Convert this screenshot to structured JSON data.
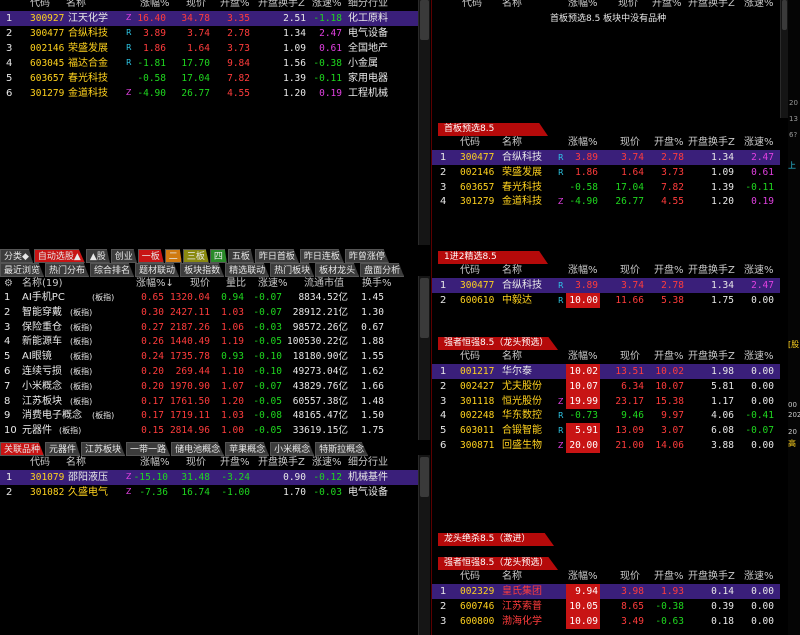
{
  "table_header": {
    "code": "代码",
    "name": "名称",
    "change": "涨幅%",
    "price": "现价",
    "open": "开盘%",
    "turnover": "开盘换手Z",
    "speed": "涨速%",
    "industry": "细分行业"
  },
  "top_left": {
    "rows": [
      {
        "idx": "1",
        "code": "300927",
        "name": "江天化学",
        "flag": "Z",
        "change": "16.40",
        "price": "34.78",
        "open": "3.35",
        "turnover": "2.51",
        "speed": "-1.18",
        "industry": "化工原料"
      },
      {
        "idx": "2",
        "code": "300477",
        "name": "合纵科技",
        "flag": "R",
        "change": "3.89",
        "price": "3.74",
        "open": "2.78",
        "turnover": "1.34",
        "speed": "2.47",
        "industry": "电气设备"
      },
      {
        "idx": "3",
        "code": "002146",
        "name": "荣盛发展",
        "flag": "R",
        "change": "1.86",
        "price": "1.64",
        "open": "3.73",
        "turnover": "1.09",
        "speed": "0.61",
        "industry": "全国地产"
      },
      {
        "idx": "4",
        "code": "603045",
        "name": "福达合金",
        "flag": "R",
        "change": "-1.81",
        "price": "17.70",
        "open": "9.84",
        "turnover": "1.56",
        "speed": "-0.38",
        "industry": "小金属"
      },
      {
        "idx": "5",
        "code": "603657",
        "name": "春光科技",
        "flag": "",
        "change": "-0.58",
        "price": "17.04",
        "open": "7.82",
        "turnover": "1.39",
        "speed": "-0.11",
        "industry": "家用电器"
      },
      {
        "idx": "6",
        "code": "301279",
        "name": "金道科技",
        "flag": "Z",
        "change": "-4.90",
        "price": "26.77",
        "open": "4.55",
        "turnover": "1.20",
        "speed": "0.19",
        "industry": "工程机械"
      }
    ]
  },
  "top_right": {
    "message": "首板预选8.5 板块中没有品种",
    "side_numbers": [
      "20",
      "13",
      "6?"
    ],
    "side_label": "上证"
  },
  "tabs1": [
    {
      "label": "分类◆",
      "style": ""
    },
    {
      "label": "自动选股▲",
      "style": "act"
    },
    {
      "label": "▲股",
      "style": ""
    },
    {
      "label": "创业",
      "style": ""
    },
    {
      "label": "一板",
      "style": "act"
    },
    {
      "label": "二",
      "style": "act2"
    },
    {
      "label": "三板",
      "style": "act4"
    },
    {
      "label": "四",
      "style": "act3"
    },
    {
      "label": "五板",
      "style": ""
    },
    {
      "label": "昨日首板",
      "style": ""
    },
    {
      "label": "昨日连板",
      "style": ""
    },
    {
      "label": "昨曾涨停",
      "style": ""
    }
  ],
  "tabs2": [
    {
      "label": "最近浏览",
      "style": ""
    },
    {
      "label": "热门分布",
      "style": ""
    },
    {
      "label": "综合排名",
      "style": ""
    },
    {
      "label": "题材联动",
      "style": ""
    },
    {
      "label": "板块指数",
      "style": ""
    },
    {
      "label": "精选联动",
      "style": ""
    },
    {
      "label": "热门板块",
      "style": ""
    },
    {
      "label": "板材龙头",
      "style": ""
    },
    {
      "label": "盘面分析",
      "style": ""
    }
  ],
  "sector_panel": {
    "header": {
      "name": "名称(19)",
      "change": "涨幅%↓",
      "price": "现价",
      "ratio": "量比",
      "speed": "涨速%",
      "cap": "流通市值",
      "turnover": "换手%"
    },
    "rows": [
      {
        "idx": "1",
        "name": "AI手机PC",
        "tag": "(板指)",
        "change": "0.65",
        "price": "1320.04",
        "ratio": "0.94",
        "speed": "-0.07",
        "cap": "8834.52亿",
        "turnover": "1.45"
      },
      {
        "idx": "2",
        "name": "智能穿戴",
        "tag": "(板指)",
        "change": "0.30",
        "price": "2427.11",
        "ratio": "1.03",
        "speed": "-0.07",
        "cap": "28912.21亿",
        "turnover": "1.30"
      },
      {
        "idx": "3",
        "name": "保险重仓",
        "tag": "(板指)",
        "change": "0.27",
        "price": "2187.26",
        "ratio": "1.06",
        "speed": "-0.03",
        "cap": "98572.26亿",
        "turnover": "0.67"
      },
      {
        "idx": "4",
        "name": "新能源车",
        "tag": "(板指)",
        "change": "0.26",
        "price": "1440.49",
        "ratio": "1.19",
        "speed": "-0.05",
        "cap": "100530.22亿",
        "turnover": "1.88"
      },
      {
        "idx": "5",
        "name": "AI眼镜",
        "tag": "(板指)",
        "change": "0.24",
        "price": "1735.78",
        "ratio": "0.93",
        "speed": "-0.10",
        "cap": "18180.90亿",
        "turnover": "1.55"
      },
      {
        "idx": "6",
        "name": "连续亏损",
        "tag": "(板指)",
        "change": "0.20",
        "price": "269.44",
        "ratio": "1.10",
        "speed": "-0.10",
        "cap": "49273.04亿",
        "turnover": "1.62"
      },
      {
        "idx": "7",
        "name": "小米概念",
        "tag": "(板指)",
        "change": "0.20",
        "price": "1970.90",
        "ratio": "1.07",
        "speed": "-0.07",
        "cap": "43829.76亿",
        "turnover": "1.66"
      },
      {
        "idx": "8",
        "name": "江苏板块",
        "tag": "(板指)",
        "change": "0.17",
        "price": "1761.50",
        "ratio": "1.20",
        "speed": "-0.05",
        "cap": "60557.38亿",
        "turnover": "1.48"
      },
      {
        "idx": "9",
        "name": "消费电子概念",
        "tag": "(板指)",
        "change": "0.17",
        "price": "1719.11",
        "ratio": "1.03",
        "speed": "-0.08",
        "cap": "48165.47亿",
        "turnover": "1.50"
      },
      {
        "idx": "10",
        "name": "元器件",
        "tag": "(板指)",
        "change": "0.15",
        "price": "2814.96",
        "ratio": "1.00",
        "speed": "-0.05",
        "cap": "33619.15亿",
        "turnover": "1.75"
      }
    ]
  },
  "tabs3": [
    {
      "label": "关联品种",
      "style": "act"
    },
    {
      "label": "元器件",
      "style": ""
    },
    {
      "label": "江苏板块",
      "style": ""
    },
    {
      "label": "一带一路",
      "style": ""
    },
    {
      "label": "储电池概念",
      "style": ""
    },
    {
      "label": "苹果概念",
      "style": ""
    },
    {
      "label": "小米概念",
      "style": ""
    },
    {
      "label": "特斯拉概念",
      "style": ""
    }
  ],
  "related": {
    "rows": [
      {
        "idx": "1",
        "code": "301079",
        "name": "邵阳液压",
        "flag": "Z",
        "change": "-15.10",
        "price": "31.48",
        "open": "-3.24",
        "turnover": "0.90",
        "speed": "-0.12",
        "industry": "机械基件"
      },
      {
        "idx": "2",
        "code": "301082",
        "name": "久盛电气",
        "flag": "Z",
        "change": "-7.36",
        "price": "16.74",
        "open": "-1.00",
        "turnover": "1.70",
        "speed": "-0.03",
        "industry": "电气设备"
      }
    ]
  },
  "shouban": {
    "title": "首板预选8.5",
    "rows": [
      {
        "idx": "1",
        "code": "300477",
        "name": "合纵科技",
        "flag": "R",
        "change": "3.89",
        "price": "3.74",
        "open": "2.78",
        "turnover": "1.34",
        "speed": "2.47"
      },
      {
        "idx": "2",
        "code": "002146",
        "name": "荣盛发展",
        "flag": "R",
        "change": "1.86",
        "price": "1.64",
        "open": "3.73",
        "turnover": "1.09",
        "speed": "0.61"
      },
      {
        "idx": "3",
        "code": "603657",
        "name": "春光科技",
        "flag": "",
        "change": "-0.58",
        "price": "17.04",
        "open": "7.82",
        "turnover": "1.39",
        "speed": "-0.11"
      },
      {
        "idx": "4",
        "code": "301279",
        "name": "金道科技",
        "flag": "Z",
        "change": "-4.90",
        "price": "26.77",
        "open": "4.55",
        "turnover": "1.20",
        "speed": "0.19"
      }
    ]
  },
  "jin2": {
    "title": "1进2精选8.5",
    "rows": [
      {
        "idx": "1",
        "code": "300477",
        "name": "合纵科技",
        "flag": "R",
        "change": "3.89",
        "price": "3.74",
        "open": "2.78",
        "turnover": "1.34",
        "speed": "2.47"
      },
      {
        "idx": "2",
        "code": "600610",
        "name": "中毅达",
        "flag": "R",
        "change": "10.00",
        "price": "11.66",
        "open": "5.38",
        "turnover": "1.75",
        "speed": "0.00"
      }
    ]
  },
  "qiangzhe1": {
    "title": "强者恒强8.5（龙头预选）",
    "rows": [
      {
        "idx": "1",
        "code": "001217",
        "name": "华尔泰",
        "flag": "",
        "change": "10.02",
        "price": "13.51",
        "open": "10.02",
        "turnover": "1.98",
        "speed": "0.00"
      },
      {
        "idx": "2",
        "code": "002427",
        "name": "尤夫股份",
        "flag": "",
        "change": "10.07",
        "price": "6.34",
        "open": "10.07",
        "turnover": "5.81",
        "speed": "0.00"
      },
      {
        "idx": "3",
        "code": "301118",
        "name": "恒光股份",
        "flag": "Z",
        "change": "19.99",
        "price": "23.17",
        "open": "15.38",
        "turnover": "1.17",
        "speed": "0.00"
      },
      {
        "idx": "4",
        "code": "002248",
        "name": "华东数控",
        "flag": "R",
        "change": "-0.73",
        "price": "9.46",
        "open": "9.97",
        "turnover": "4.06",
        "speed": "-0.41"
      },
      {
        "idx": "5",
        "code": "603011",
        "name": "合锻智能",
        "flag": "R",
        "change": "5.91",
        "price": "13.09",
        "open": "3.07",
        "turnover": "6.08",
        "speed": "-0.07"
      },
      {
        "idx": "6",
        "code": "300871",
        "name": "回盛生物",
        "flag": "Z",
        "change": "20.00",
        "price": "21.00",
        "open": "14.06",
        "turnover": "3.88",
        "speed": "0.00"
      }
    ]
  },
  "longtou": {
    "title": "龙头绝杀8.5（激进）"
  },
  "qiangzhe2": {
    "title": "强者恒强8.5（龙头预选）",
    "rows": [
      {
        "idx": "1",
        "code": "002329",
        "name": "皇氏集团",
        "flag": "",
        "change": "9.94",
        "price": "3.98",
        "open": "1.93",
        "turnover": "0.14",
        "speed": "0.00"
      },
      {
        "idx": "2",
        "code": "600746",
        "name": "江苏索普",
        "flag": "",
        "change": "10.05",
        "price": "8.65",
        "open": "-0.38",
        "turnover": "0.39",
        "speed": "0.00"
      },
      {
        "idx": "3",
        "code": "600800",
        "name": "渤海化学",
        "flag": "",
        "change": "10.09",
        "price": "3.49",
        "open": "-0.63",
        "turnover": "0.18",
        "speed": "0.00"
      }
    ]
  },
  "right_edge": {
    "labels": [
      "[股",
      "00",
      "202",
      "20",
      "高荐"
    ]
  }
}
